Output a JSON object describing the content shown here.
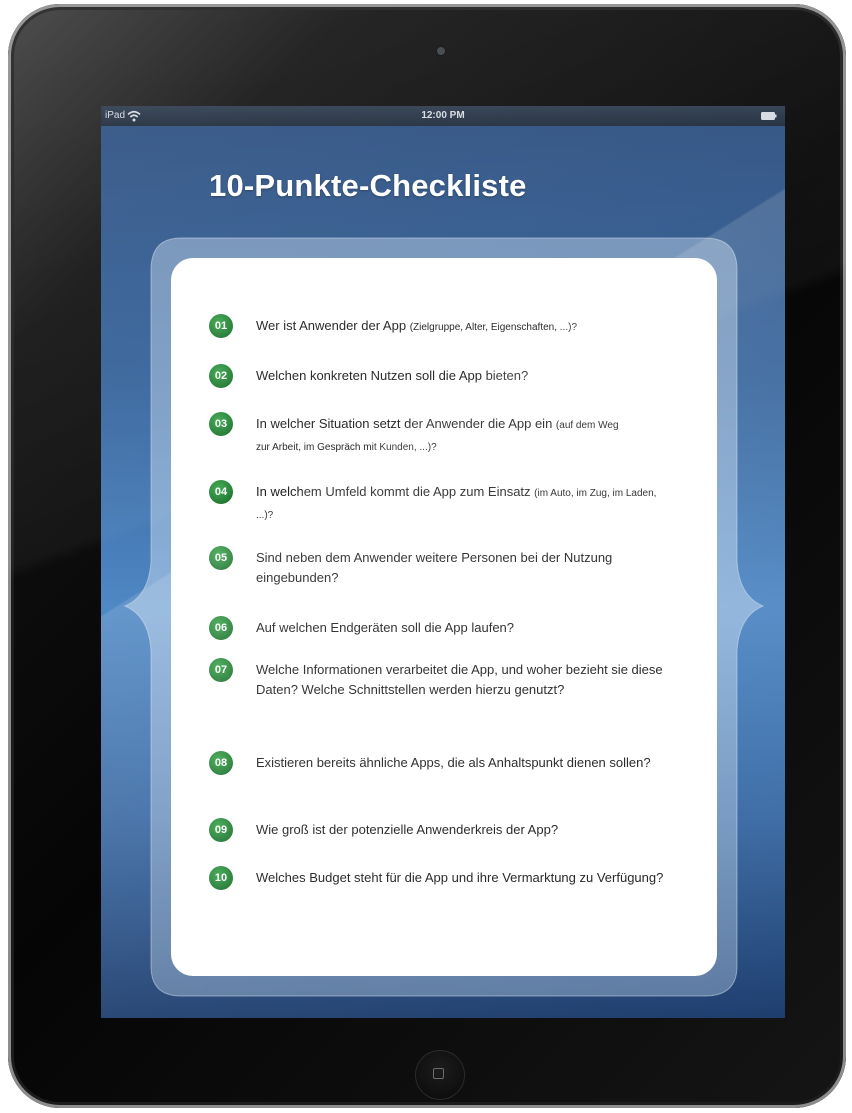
{
  "status_bar": {
    "carrier": "iPad",
    "time": "12:00 PM",
    "wifi_icon": "wifi-icon",
    "battery_icon": "battery-icon"
  },
  "title": "10-Punkte-Checkliste",
  "colors": {
    "badge_green": "#217a33",
    "screen_blue": "#35639b",
    "card_white": "#ffffff"
  },
  "items": [
    {
      "number": "01",
      "text": "Wer ist Anwender der App ",
      "note": "(Zielgruppe, Alter, Eigenschaften, ...)?"
    },
    {
      "number": "02",
      "text": "Welchen konkreten Nutzen soll die App bieten?",
      "note": ""
    },
    {
      "number": "03",
      "text": "In welcher Situation setzt der Anwender die App ein ",
      "note": "(auf dem Weg zur Arbeit, im Gespräch mit Kunden, ...)?"
    },
    {
      "number": "04",
      "text": "In welchem Umfeld kommt die App zum Einsatz ",
      "note": "(im Auto, im Zug, im Laden, ...)?"
    },
    {
      "number": "05",
      "text": "Sind neben dem Anwender weitere Personen bei der Nutzung eingebunden?",
      "note": ""
    },
    {
      "number": "06",
      "text": "Auf welchen Endgeräten soll die App laufen?",
      "note": ""
    },
    {
      "number": "07",
      "text": "Welche Informationen verarbeitet die App, und woher bezieht sie diese Daten? Welche Schnittstellen werden hierzu genutzt?",
      "note": ""
    },
    {
      "number": "08",
      "text": "Existieren bereits ähnliche Apps, die als Anhaltspunkt dienen sollen?",
      "note": ""
    },
    {
      "number": "09",
      "text": "Wie groß ist der potenzielle Anwenderkreis der App?",
      "note": ""
    },
    {
      "number": "10",
      "text": "Welches Budget steht für die App und ihre Vermarktung zu Verfügung?",
      "note": ""
    }
  ]
}
